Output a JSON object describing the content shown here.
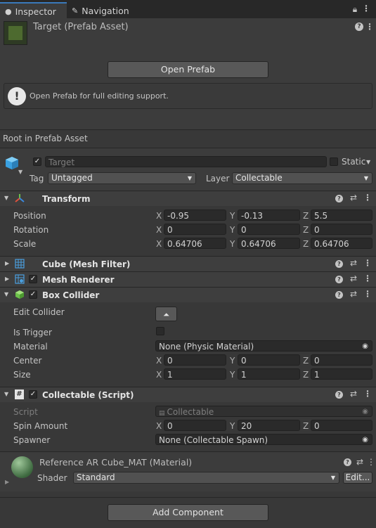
{
  "tabs": [
    {
      "label": "Inspector",
      "icon": "info-icon"
    },
    {
      "label": "Navigation",
      "icon": "brush-icon"
    }
  ],
  "header": {
    "title": "Target (Prefab Asset)",
    "open_prefab": "Open Prefab",
    "info": "Open Prefab for full editing support.",
    "root_label": "Root in Prefab Asset"
  },
  "object": {
    "name": "Target",
    "static_label": "Static",
    "tag_label": "Tag",
    "tag_value": "Untagged",
    "layer_label": "Layer",
    "layer_value": "Collectable"
  },
  "transform": {
    "title": "Transform",
    "position": {
      "label": "Position",
      "x": "-0.95",
      "y": "-0.13",
      "z": "5.5"
    },
    "rotation": {
      "label": "Rotation",
      "x": "0",
      "y": "0",
      "z": "0"
    },
    "scale": {
      "label": "Scale",
      "x": "0.64706",
      "y": "0.64706",
      "z": "0.64706"
    }
  },
  "axes": {
    "x": "X",
    "y": "Y",
    "z": "Z"
  },
  "mesh_filter": {
    "title": "Cube (Mesh Filter)"
  },
  "mesh_renderer": {
    "title": "Mesh Renderer"
  },
  "box_collider": {
    "title": "Box Collider",
    "edit_collider": "Edit Collider",
    "is_trigger": "Is Trigger",
    "material_label": "Material",
    "material_value": "None (Physic Material)",
    "center": {
      "label": "Center",
      "x": "0",
      "y": "0",
      "z": "0"
    },
    "size": {
      "label": "Size",
      "x": "1",
      "y": "1",
      "z": "1"
    }
  },
  "script": {
    "title": "Collectable (Script)",
    "script_label": "Script",
    "script_value": "Collectable",
    "spin": {
      "label": "Spin Amount",
      "x": "0",
      "y": "20",
      "z": "0"
    },
    "spawner_label": "Spawner",
    "spawner_value": "None (Collectable Spawn)"
  },
  "material": {
    "title": "Reference AR Cube_MAT (Material)",
    "shader_label": "Shader",
    "shader_value": "Standard",
    "edit": "Edit..."
  },
  "add_component": "Add Component",
  "colors": {
    "tab_accent": "#3a79bb",
    "panel": "#383838",
    "header": "#3c3c3c"
  }
}
